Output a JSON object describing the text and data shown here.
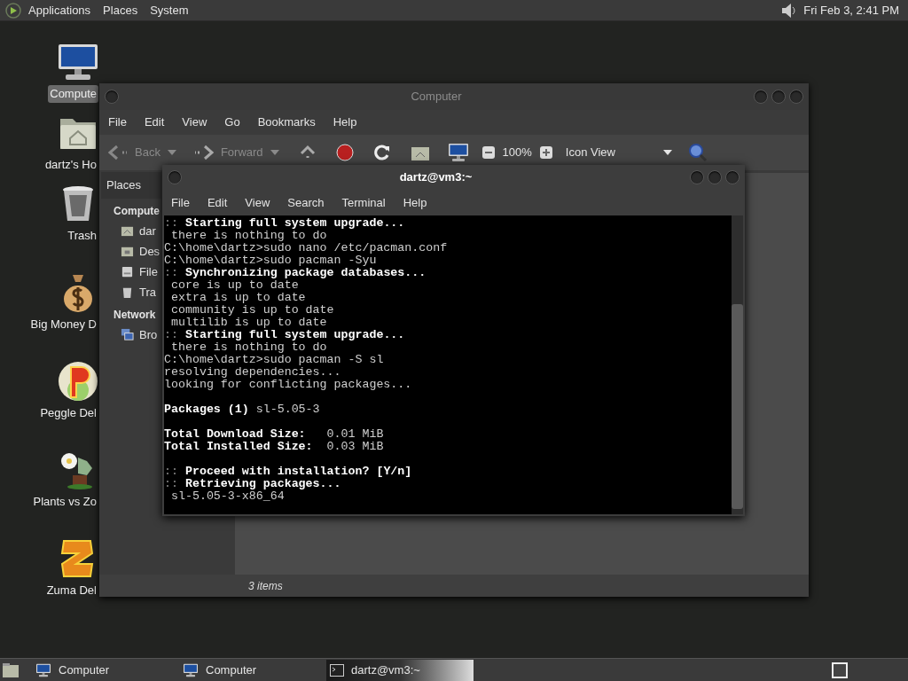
{
  "top_panel": {
    "menus": [
      "Applications",
      "Places",
      "System"
    ],
    "clock": "Fri Feb 3, 2:41 PM"
  },
  "desktop_icons": [
    {
      "kind": "computer",
      "label": "Compute",
      "selected": true
    },
    {
      "kind": "home",
      "label": "dartz's Ho",
      "selected": false
    },
    {
      "kind": "trash",
      "label": "Trash",
      "selected": false
    },
    {
      "kind": "money",
      "label": "Big Money D",
      "selected": false
    },
    {
      "kind": "peggle",
      "label": "Peggle Del",
      "selected": false
    },
    {
      "kind": "plant",
      "label": "Plants vs Zo",
      "selected": false
    },
    {
      "kind": "zuma",
      "label": "Zuma Del",
      "selected": false
    }
  ],
  "file_manager": {
    "title": "Computer",
    "menu": [
      "File",
      "Edit",
      "View",
      "Go",
      "Bookmarks",
      "Help"
    ],
    "toolbar": {
      "back": "Back",
      "forward": "Forward",
      "zoom": "100%",
      "view": "Icon View"
    },
    "side_pane": {
      "title": "Places",
      "sections": [
        {
          "heading": "Compute",
          "items": [
            {
              "kind": "home",
              "label": "dar"
            },
            {
              "kind": "desktop",
              "label": "Des"
            },
            {
              "kind": "drive",
              "label": "File"
            },
            {
              "kind": "trash",
              "label": "Tra"
            }
          ]
        },
        {
          "heading": "Network",
          "items": [
            {
              "kind": "network",
              "label": "Bro"
            }
          ]
        }
      ]
    },
    "status": "3 items"
  },
  "terminal": {
    "title": "dartz@vm3:~",
    "menu": [
      "File",
      "Edit",
      "View",
      "Search",
      "Terminal",
      "Help"
    ],
    "lines": [
      {
        "kind": "header",
        "prefix": "::",
        "text": "Starting full system upgrade..."
      },
      {
        "kind": "plain",
        "text": " there is nothing to do"
      },
      {
        "kind": "plain",
        "text": "C:\\home\\dartz>sudo nano /etc/pacman.conf"
      },
      {
        "kind": "plain",
        "text": "C:\\home\\dartz>sudo pacman -Syu"
      },
      {
        "kind": "header",
        "prefix": "::",
        "text": "Synchronizing package databases..."
      },
      {
        "kind": "plain",
        "text": " core is up to date"
      },
      {
        "kind": "plain",
        "text": " extra is up to date"
      },
      {
        "kind": "plain",
        "text": " community is up to date"
      },
      {
        "kind": "plain",
        "text": " multilib is up to date"
      },
      {
        "kind": "header",
        "prefix": "::",
        "text": "Starting full system upgrade..."
      },
      {
        "kind": "plain",
        "text": " there is nothing to do"
      },
      {
        "kind": "plain",
        "text": "C:\\home\\dartz>sudo pacman -S sl"
      },
      {
        "kind": "plain",
        "text": "resolving dependencies..."
      },
      {
        "kind": "plain",
        "text": "looking for conflicting packages..."
      },
      {
        "kind": "blank"
      },
      {
        "kind": "plain",
        "text": "**Packages (1)** sl-5.05-3"
      },
      {
        "kind": "blank"
      },
      {
        "kind": "plain",
        "text": "**Total Download Size:**   0.01 MiB"
      },
      {
        "kind": "plain",
        "text": "**Total Installed Size:**  0.03 MiB"
      },
      {
        "kind": "blank"
      },
      {
        "kind": "header",
        "prefix": "::",
        "text": "Proceed with installation? [Y/n]"
      },
      {
        "kind": "header",
        "prefix": "::",
        "text": "Retrieving packages..."
      },
      {
        "kind": "plain",
        "text": " sl-5.05-3-x86_64"
      }
    ]
  },
  "taskbar": {
    "tasks": [
      {
        "kind": "computer",
        "label": "Computer",
        "selected": false
      },
      {
        "kind": "computer",
        "label": "Computer",
        "selected": false
      },
      {
        "kind": "terminal",
        "label": "dartz@vm3:~",
        "selected": true
      }
    ]
  }
}
